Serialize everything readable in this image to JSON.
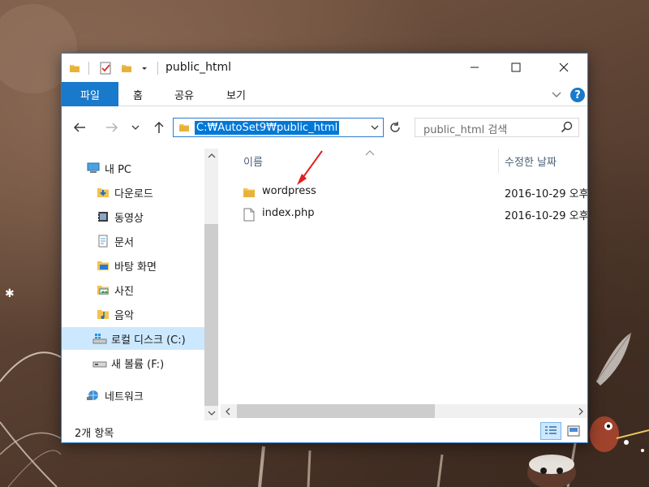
{
  "window": {
    "title": "public_html",
    "buttons": {
      "minimize": "minimize",
      "maximize": "maximize",
      "close": "close"
    }
  },
  "ribbon": {
    "tabs": [
      {
        "label": "파일",
        "active": true
      },
      {
        "label": "홈"
      },
      {
        "label": "공유"
      },
      {
        "label": "보기"
      }
    ],
    "help": "?"
  },
  "address": {
    "path": "C:₩AutoSet9₩public_html"
  },
  "search": {
    "placeholder": "public_html 검색"
  },
  "nav": {
    "items": [
      {
        "label": "내 PC",
        "icon": "computer-icon"
      },
      {
        "label": "다운로드",
        "icon": "downloads-icon"
      },
      {
        "label": "동영상",
        "icon": "videos-icon"
      },
      {
        "label": "문서",
        "icon": "documents-icon"
      },
      {
        "label": "바탕 화면",
        "icon": "desktop-icon"
      },
      {
        "label": "사진",
        "icon": "pictures-icon"
      },
      {
        "label": "음악",
        "icon": "music-icon"
      },
      {
        "label": "로컬 디스크 (C:)",
        "icon": "local-disk-icon",
        "selected": true
      },
      {
        "label": "새 볼륨 (F:)",
        "icon": "drive-icon"
      },
      {
        "label": "네트워크",
        "icon": "network-icon"
      }
    ]
  },
  "content": {
    "columns": {
      "name": "이름",
      "date": "수정한 날짜"
    },
    "files": [
      {
        "name": "wordpress",
        "date": "2016-10-29 오후",
        "icon": "folder-icon"
      },
      {
        "name": "index.php",
        "date": "2016-10-29 오후",
        "icon": "file-icon"
      }
    ]
  },
  "status": {
    "count": "2개 항목"
  },
  "colors": {
    "accent": "#1979ca",
    "selection": "#cce8ff",
    "address_highlight": "#0078d7",
    "annotation_arrow": "#e02020"
  }
}
